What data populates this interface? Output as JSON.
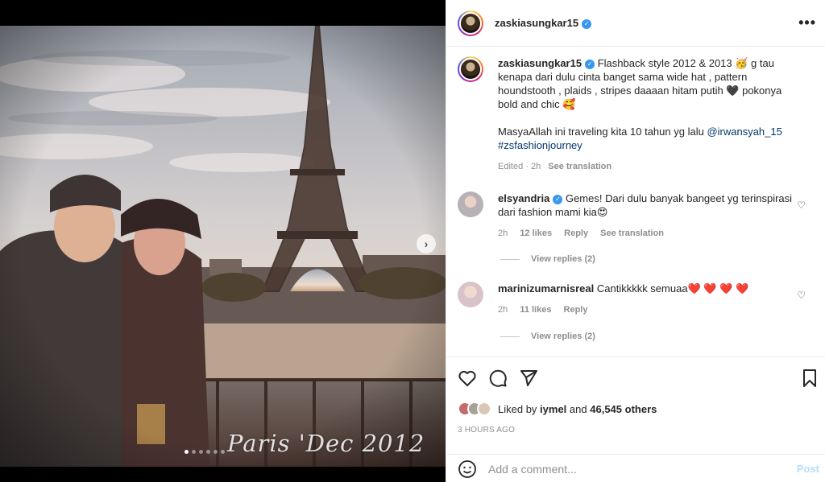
{
  "post": {
    "username": "zaskiasungkar15",
    "watermark": "Paris 'Dec 2012",
    "carousel": {
      "total_slides": 6,
      "active_slide": 1
    }
  },
  "header": {
    "username": "zaskiasungkar15",
    "more_label": "•••"
  },
  "caption": {
    "username": "zaskiasungkar15",
    "text_1": "Flashback style 2012 & 2013 🥳 g tau kenapa dari dulu cinta banget sama wide hat , pattern houndstooth , plaids , stripes daaaan hitam putih 🖤 pokonya bold and chic 🥰",
    "text_2": "MasyaAllah ini traveling kita 10 tahun yg lalu",
    "mention": "@irwansyah_15",
    "hashtag": "#zsfashionjourney",
    "edited": "Edited · 2h",
    "see_translation": "See translation"
  },
  "comments": [
    {
      "username": "elsyandria",
      "text": "Gemes! Dari dulu banyak bangeet yg terinspirasi dari fashion mami kia😍",
      "time": "2h",
      "likes": "12 likes",
      "reply": "Reply",
      "see_translation": "See translation",
      "view_replies": "View replies (2)"
    },
    {
      "username": "marinizumarnisreal",
      "text": "Cantikkkkk semuaa❤️ ❤️ ❤️ ❤️",
      "time": "2h",
      "likes": "11 likes",
      "reply": "Reply",
      "view_replies": "View replies (2)"
    }
  ],
  "likes": {
    "prefix": "Liked by",
    "user": "iymel",
    "and": "and",
    "count": "46,545 others"
  },
  "timestamp": "3 HOURS AGO",
  "comment_box": {
    "placeholder": "Add a comment...",
    "post_label": "Post"
  },
  "colors": {
    "accent": "#0095f6",
    "link": "#00376b",
    "muted": "#8e8e8e",
    "heart": "#ed4956"
  }
}
